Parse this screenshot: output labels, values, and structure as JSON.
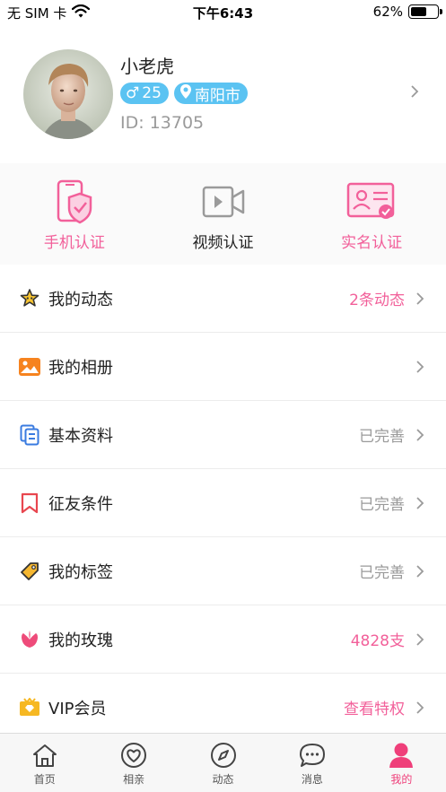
{
  "status_bar": {
    "carrier": "无 SIM 卡",
    "time": "下午6:43",
    "battery_percent": "62%",
    "battery_level": 0.62
  },
  "profile": {
    "name": "小老虎",
    "gender_symbol": "♂",
    "age": "25",
    "city": "南阳市",
    "id_text": "ID: 13705"
  },
  "verify": {
    "items": [
      {
        "label": "手机认证",
        "icon": "phone-shield-icon",
        "color": "#f2609a"
      },
      {
        "label": "视频认证",
        "icon": "video-camera-icon",
        "color": "#222222"
      },
      {
        "label": "实名认证",
        "icon": "id-card-icon",
        "color": "#f2609a"
      }
    ]
  },
  "menu": {
    "items": [
      {
        "label": "我的动态",
        "value": "2条动态",
        "icon": "star-face-icon"
      },
      {
        "label": "我的相册",
        "value": "",
        "icon": "photo-album-icon"
      },
      {
        "label": "基本资料",
        "value": "已完善",
        "icon": "document-icon"
      },
      {
        "label": "征友条件",
        "value": "已完善",
        "icon": "bookmark-icon"
      },
      {
        "label": "我的标签",
        "value": "已完善",
        "icon": "tag-icon"
      },
      {
        "label": "我的玫瑰",
        "value": "4828支",
        "icon": "rose-icon"
      },
      {
        "label": "VIP会员",
        "value": "查看特权",
        "icon": "vip-crown-icon"
      }
    ]
  },
  "tabbar": {
    "items": [
      {
        "label": "首页",
        "icon": "home-icon"
      },
      {
        "label": "相亲",
        "icon": "heart-icon"
      },
      {
        "label": "动态",
        "icon": "compass-icon"
      },
      {
        "label": "消息",
        "icon": "message-icon"
      },
      {
        "label": "我的",
        "icon": "user-icon"
      }
    ],
    "active_index": 4
  },
  "colors": {
    "accent_pink": "#f2609a",
    "tab_active": "#ef3f7a",
    "badge_blue": "#5bc3f2",
    "muted_gray": "#9a9a9a"
  }
}
